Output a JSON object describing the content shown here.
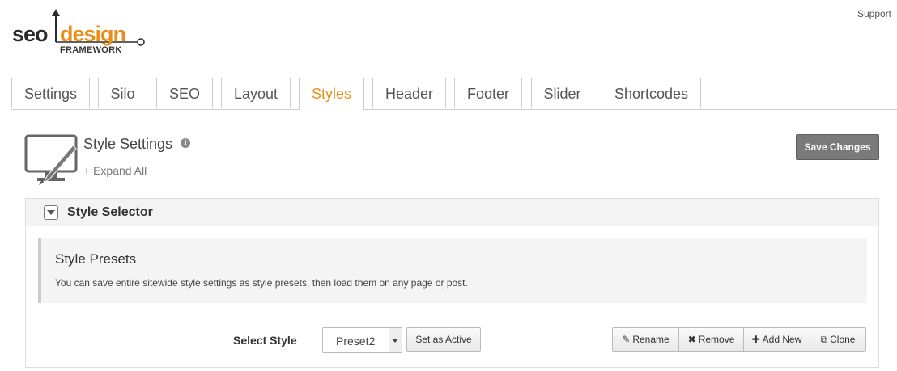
{
  "header": {
    "support_link": "Support",
    "logo": {
      "word1": "seo",
      "word2": "design",
      "word3": "FRAMEWORK"
    }
  },
  "tabs": [
    {
      "label": "Settings"
    },
    {
      "label": "Silo"
    },
    {
      "label": "SEO"
    },
    {
      "label": "Layout"
    },
    {
      "label": "Styles"
    },
    {
      "label": "Header"
    },
    {
      "label": "Footer"
    },
    {
      "label": "Slider"
    },
    {
      "label": "Shortcodes"
    }
  ],
  "active_tab": "Styles",
  "page": {
    "title": "Style Settings",
    "expand_all": "+ Expand All",
    "save_label": "Save Changes"
  },
  "panel": {
    "title": "Style Selector",
    "presets": {
      "title": "Style Presets",
      "description": "You can save entire sitewide style settings as style presets, then load them on any page or post."
    },
    "select_label": "Select Style",
    "select_value": "Preset2",
    "set_active_label": "Set as Active",
    "actions": {
      "rename": "Rename",
      "remove": "Remove",
      "add_new": "Add New",
      "clone": "Clone"
    }
  },
  "colors": {
    "accent": "#e8901a",
    "save_button_bg": "#7a7a7a"
  },
  "icons": [
    "monitor-brush-icon",
    "info-icon",
    "collapse-toggle-icon",
    "pencil-icon",
    "x-icon",
    "plus-icon",
    "copy-icon",
    "dropdown-arrow-icon"
  ]
}
